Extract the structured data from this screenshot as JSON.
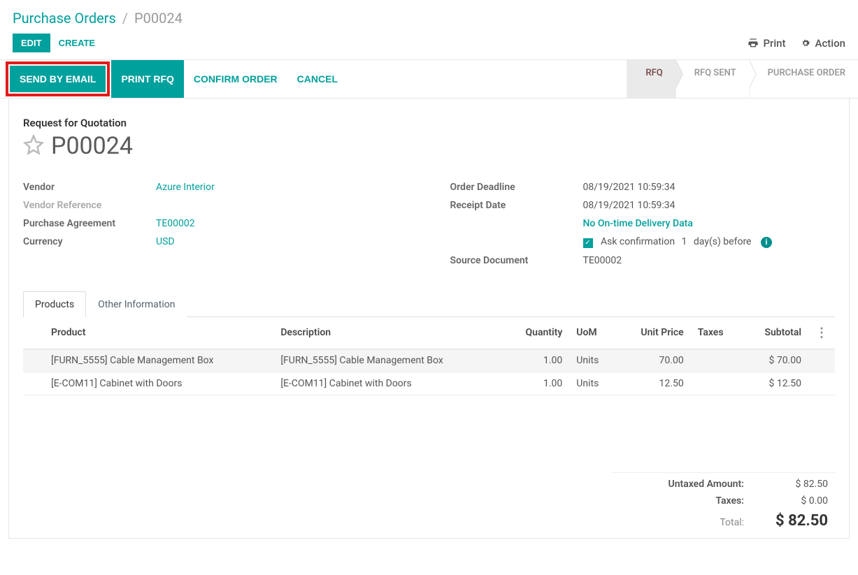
{
  "breadcrumb": {
    "root": "Purchase Orders",
    "sep": "/",
    "current": "P00024"
  },
  "topbar": {
    "edit": "EDIT",
    "create": "CREATE",
    "print": "Print",
    "action": "Action"
  },
  "statusbar": {
    "send_by_email": "SEND BY EMAIL",
    "print_rfq": "PRINT RFQ",
    "confirm_order": "CONFIRM ORDER",
    "cancel": "CANCEL",
    "stages": {
      "rfq": "RFQ",
      "rfq_sent": "RFQ SENT",
      "po": "PURCHASE ORDER"
    }
  },
  "doc": {
    "subtitle": "Request for Quotation",
    "name": "P00024",
    "left": {
      "vendor_label": "Vendor",
      "vendor_value": "Azure Interior",
      "vendor_ref_label": "Vendor Reference",
      "vendor_ref_value": "",
      "pa_label": "Purchase Agreement",
      "pa_value": "TE00002",
      "currency_label": "Currency",
      "currency_value": "USD"
    },
    "right": {
      "deadline_label": "Order Deadline",
      "deadline_value": "08/19/2021 10:59:34",
      "receipt_label": "Receipt Date",
      "receipt_value": "08/19/2021 10:59:34",
      "ontime": "No On-time Delivery Data",
      "ask_conf": "Ask confirmation",
      "ask_days": "1",
      "ask_suffix": "day(s) before",
      "source_label": "Source Document",
      "source_value": "TE00002"
    }
  },
  "tabs": {
    "products": "Products",
    "other": "Other Information"
  },
  "table": {
    "headers": {
      "product": "Product",
      "desc": "Description",
      "qty": "Quantity",
      "uom": "UoM",
      "unit": "Unit Price",
      "taxes": "Taxes",
      "subtotal": "Subtotal"
    },
    "rows": [
      {
        "product": "[FURN_5555] Cable Management Box",
        "desc": "[FURN_5555] Cable Management Box",
        "qty": "1.00",
        "uom": "Units",
        "unit": "70.00",
        "taxes": "",
        "subtotal": "$ 70.00"
      },
      {
        "product": "[E-COM11] Cabinet with Doors",
        "desc": "[E-COM11] Cabinet with Doors",
        "qty": "1.00",
        "uom": "Units",
        "unit": "12.50",
        "taxes": "",
        "subtotal": "$ 12.50"
      }
    ]
  },
  "totals": {
    "untaxed_label": "Untaxed Amount:",
    "untaxed_value": "$ 82.50",
    "taxes_label": "Taxes:",
    "taxes_value": "$ 0.00",
    "total_label": "Total:",
    "total_value": "$ 82.50"
  }
}
